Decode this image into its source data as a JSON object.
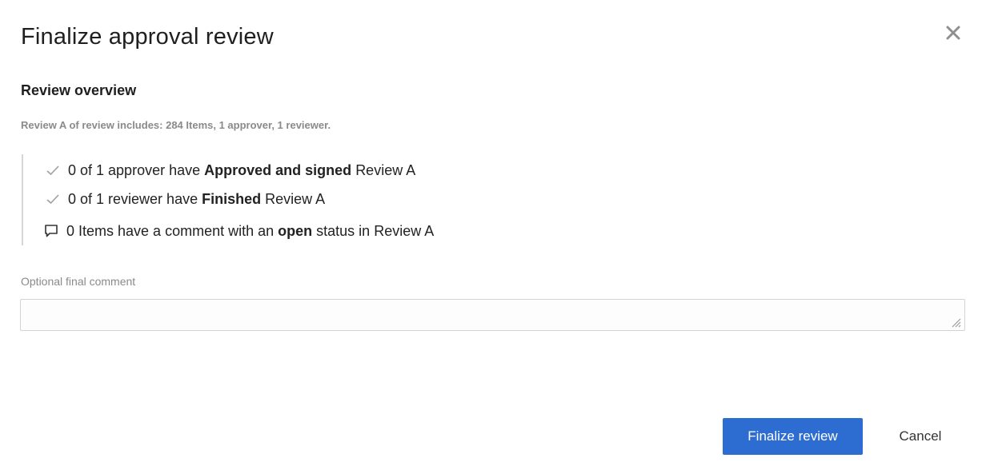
{
  "dialog": {
    "title": "Finalize approval review",
    "close_icon": "close-icon"
  },
  "overview": {
    "heading": "Review overview",
    "summary": "Review A of review includes: 284 Items, 1 approver, 1 reviewer."
  },
  "status_items": [
    {
      "icon": "check-icon",
      "before": "0 of 1 approver have",
      "bold": "Approved and signed",
      "after": "Review A"
    },
    {
      "icon": "check-icon",
      "before": "0 of 1 reviewer have",
      "bold": "Finished",
      "after": "Review A"
    },
    {
      "icon": "comment-icon",
      "before": "0 Items have a comment with an",
      "bold": "open",
      "after": "status in Review A"
    }
  ],
  "comment": {
    "label": "Optional final comment",
    "value": ""
  },
  "actions": {
    "finalize_label": "Finalize review",
    "cancel_label": "Cancel"
  },
  "colors": {
    "primary": "#2d6dd1",
    "muted_text": "#8a8a8a",
    "check": "#9aa0a6"
  }
}
